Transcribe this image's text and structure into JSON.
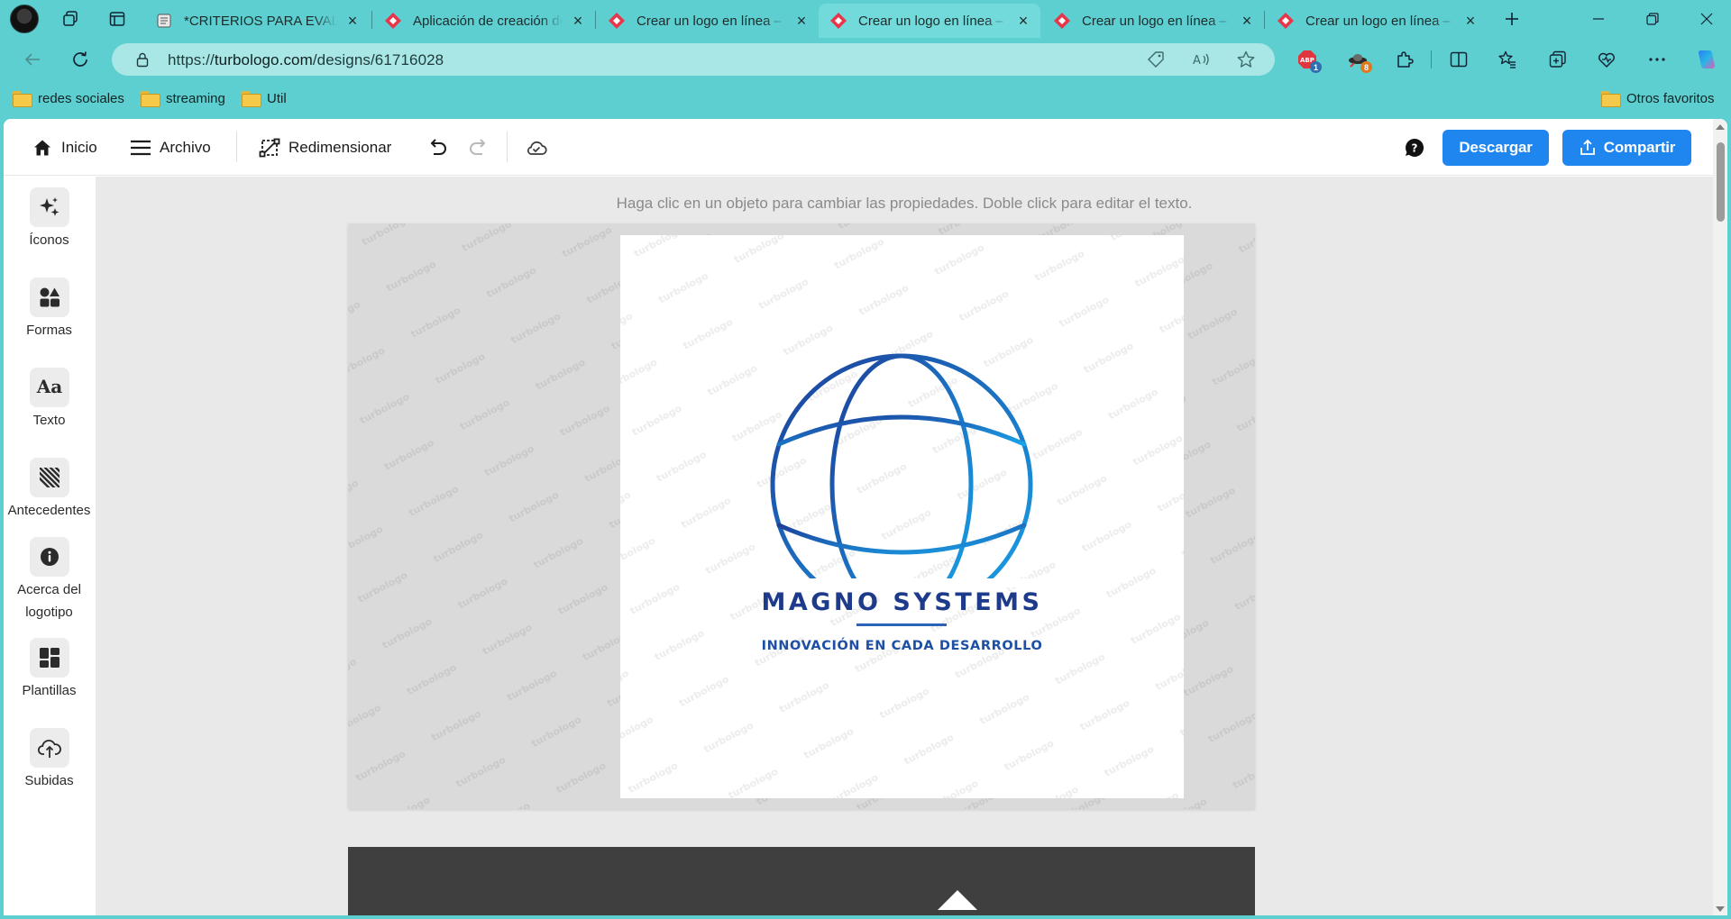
{
  "browser": {
    "tabs": [
      {
        "title": "*CRITERIOS PARA EVALUAR",
        "icon": "document-icon",
        "active": false
      },
      {
        "title": "Aplicación de creación de",
        "icon": "turbologo-icon",
        "active": false
      },
      {
        "title": "Crear un logo en línea – C",
        "icon": "turbologo-icon",
        "active": false
      },
      {
        "title": "Crear un logo en línea – C",
        "icon": "turbologo-icon",
        "active": true
      },
      {
        "title": "Crear un logo en línea – C",
        "icon": "turbologo-icon",
        "active": false
      },
      {
        "title": "Crear un logo en línea – C",
        "icon": "turbologo-icon",
        "active": false
      }
    ],
    "url_prefix": "https://",
    "url_host": "turbologo.com",
    "url_path": "/designs/61716028",
    "extensions": [
      {
        "icon": "adblock-icon",
        "badge": "1",
        "badge_color": "#2f6fb0"
      },
      {
        "icon": "ufo-extension-icon",
        "badge": "8",
        "badge_color": "#e0781e"
      }
    ],
    "bookmarks": [
      "redes sociales",
      "streaming",
      "Util"
    ],
    "other_bookmarks": "Otros favoritos"
  },
  "toolbar": {
    "home_label": "Inicio",
    "file_label": "Archivo",
    "resize_label": "Redimensionar",
    "download_label": "Descargar",
    "share_label": "Compartir"
  },
  "sidebar": {
    "items": [
      {
        "label": "Íconos",
        "icon": "sparkles-icon"
      },
      {
        "label": "Formas",
        "icon": "shapes-icon"
      },
      {
        "label": "Texto",
        "icon": "text-icon"
      },
      {
        "label": "Antecedentes",
        "icon": "background-pattern-icon"
      },
      {
        "label": "Acerca del logotipo",
        "icon": "info-icon"
      },
      {
        "label": "Plantillas",
        "icon": "templates-icon"
      },
      {
        "label": "Subidas",
        "icon": "upload-cloud-icon"
      }
    ]
  },
  "editor": {
    "hint": "Haga clic en un objeto para cambiar las propiedades. Doble click para editar el texto.",
    "watermark": "turbologo",
    "logo": {
      "name": "MAGNO SYSTEMS",
      "tagline": "INNOVACIÓN EN CADA DESARROLLO",
      "gradient_start": "#1d3f9a",
      "gradient_end": "#1aa3e8",
      "text_color": "#1e3a8a",
      "tagline_color": "#1d4fa6"
    }
  },
  "colors": {
    "browser_frame": "#5ecfd0",
    "primary_button": "#1f86f0"
  }
}
